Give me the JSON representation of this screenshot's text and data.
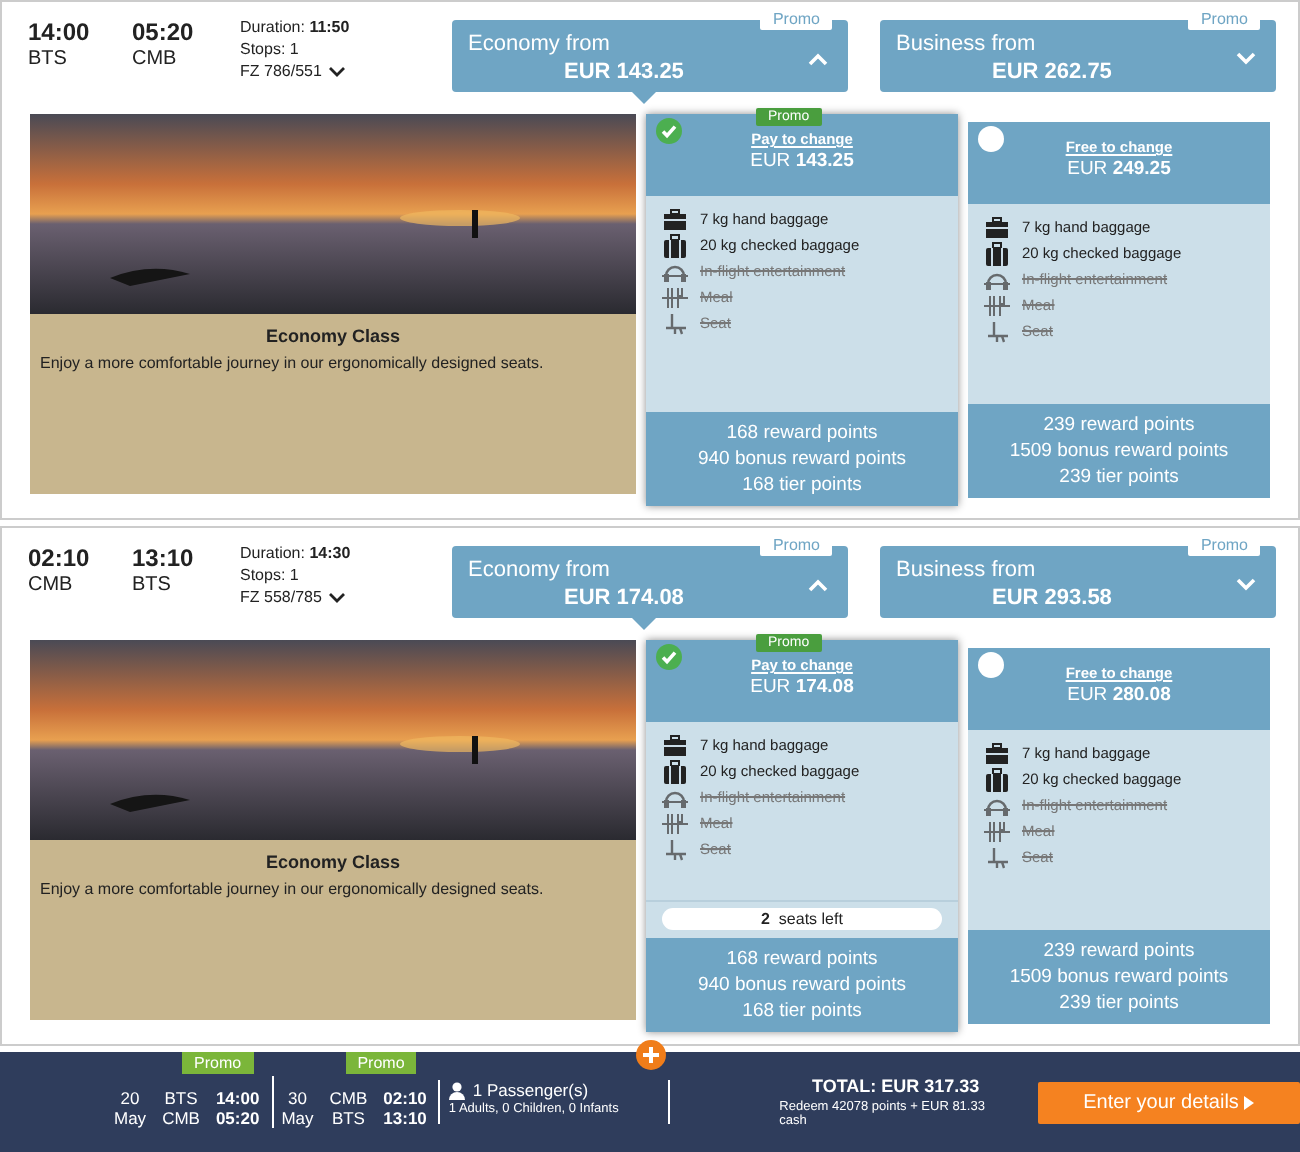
{
  "flights": [
    {
      "depart_time": "14:00",
      "depart_code": "BTS",
      "arrive_time": "05:20",
      "arrive_code": "CMB",
      "duration_label": "Duration:",
      "duration": "11:50",
      "stops": "Stops: 1",
      "flight_no": "FZ 786/551",
      "cabins": [
        {
          "label": "Economy from",
          "price": "EUR 143.25",
          "promo": "Promo",
          "expanded": true
        },
        {
          "label": "Business from",
          "price": "EUR 262.75",
          "promo": "Promo",
          "expanded": false
        }
      ],
      "image": {
        "title": "Economy Class",
        "description": "Enjoy a more comfortable journey in our ergonomically designed seats."
      },
      "fares": [
        {
          "selected": true,
          "promo": "Promo",
          "change": "Pay to change",
          "currency": "EUR",
          "price": "143.25",
          "features": [
            {
              "kind": "hand",
              "text": "7 kg hand baggage",
              "included": true
            },
            {
              "kind": "checked",
              "text": "20 kg checked baggage",
              "included": true
            },
            {
              "kind": "entertainment",
              "text": "In-flight entertainment",
              "included": false
            },
            {
              "kind": "meal",
              "text": "Meal",
              "included": false
            },
            {
              "kind": "seat",
              "text": "Seat",
              "included": false
            }
          ],
          "points": [
            "168 reward points",
            "940 bonus reward points",
            "168 tier points"
          ]
        },
        {
          "selected": false,
          "change": "Free to change",
          "currency": "EUR",
          "price": "249.25",
          "features": [
            {
              "kind": "hand",
              "text": "7 kg hand baggage",
              "included": true
            },
            {
              "kind": "checked",
              "text": "20 kg checked baggage",
              "included": true
            },
            {
              "kind": "entertainment",
              "text": "In-flight entertainment",
              "included": false
            },
            {
              "kind": "meal",
              "text": "Meal",
              "included": false
            },
            {
              "kind": "seat",
              "text": "Seat",
              "included": false
            }
          ],
          "points": [
            "239 reward points",
            "1509 bonus reward points",
            "239 tier points"
          ]
        }
      ]
    },
    {
      "depart_time": "02:10",
      "depart_code": "CMB",
      "arrive_time": "13:10",
      "arrive_code": "BTS",
      "duration_label": "Duration:",
      "duration": "14:30",
      "stops": "Stops: 1",
      "flight_no": "FZ 558/785",
      "cabins": [
        {
          "label": "Economy from",
          "price": "EUR 174.08",
          "promo": "Promo",
          "expanded": true
        },
        {
          "label": "Business from",
          "price": "EUR 293.58",
          "promo": "Promo",
          "expanded": false
        }
      ],
      "image": {
        "title": "Economy Class",
        "description": "Enjoy a more comfortable journey in our ergonomically designed seats."
      },
      "fares": [
        {
          "selected": true,
          "promo": "Promo",
          "change": "Pay to change",
          "currency": "EUR",
          "price": "174.08",
          "features": [
            {
              "kind": "hand",
              "text": "7 kg hand baggage",
              "included": true
            },
            {
              "kind": "checked",
              "text": "20 kg checked baggage",
              "included": true
            },
            {
              "kind": "entertainment",
              "text": "In-flight entertainment",
              "included": false
            },
            {
              "kind": "meal",
              "text": "Meal",
              "included": false
            },
            {
              "kind": "seat",
              "text": "Seat",
              "included": false
            }
          ],
          "seats_left": {
            "count": "2",
            "text": "seats left"
          },
          "points": [
            "168 reward points",
            "940 bonus reward points",
            "168 tier points"
          ]
        },
        {
          "selected": false,
          "change": "Free to change",
          "currency": "EUR",
          "price": "280.08",
          "features": [
            {
              "kind": "hand",
              "text": "7 kg hand baggage",
              "included": true
            },
            {
              "kind": "checked",
              "text": "20 kg checked baggage",
              "included": true
            },
            {
              "kind": "entertainment",
              "text": "In-flight entertainment",
              "included": false
            },
            {
              "kind": "meal",
              "text": "Meal",
              "included": false
            },
            {
              "kind": "seat",
              "text": "Seat",
              "included": false
            }
          ],
          "points": [
            "239 reward points",
            "1509 bonus reward points",
            "239 tier points"
          ]
        }
      ]
    }
  ],
  "summary": {
    "legs": [
      {
        "promo": "Promo",
        "day": "20",
        "month": "May",
        "from": "BTS",
        "from_time": "14:00",
        "to": "CMB",
        "to_time": "05:20"
      },
      {
        "promo": "Promo",
        "day": "30",
        "month": "May",
        "from": "CMB",
        "from_time": "02:10",
        "to": "BTS",
        "to_time": "13:10"
      }
    ],
    "passengers": "1 Passenger(s)",
    "breakdown": "1 Adults, 0 Children, 0 Infants",
    "total": "TOTAL: EUR 317.33",
    "redeem": "Redeem 42078 points + EUR 81.33 cash",
    "button": "Enter your details"
  }
}
